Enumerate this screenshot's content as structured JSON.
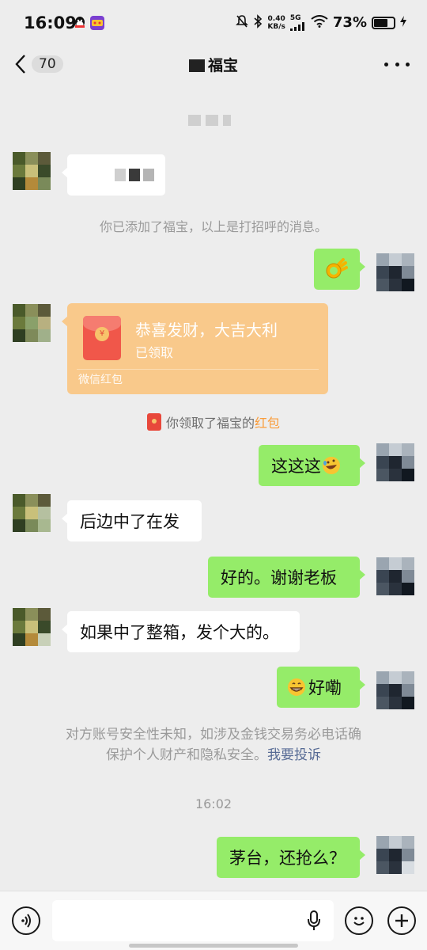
{
  "status_bar": {
    "time": "16:09",
    "network_speed_value": "0.40",
    "network_speed_unit": "KB/s",
    "signal_label": "5G",
    "battery_percent": "73%",
    "battery_level": 0.73
  },
  "nav": {
    "unread_count": "70",
    "title": "福宝",
    "back_icon": "chevron-left-icon",
    "more_icon": "more-dots-icon"
  },
  "messages": {
    "m1_emoji_name": "ok-hand-emoji",
    "system_added": "你已添加了福宝，以上是打招呼的消息。",
    "red_packet": {
      "title": "恭喜发财，大吉大利",
      "status": "已领取",
      "footer": "微信红包"
    },
    "received_notice_prefix": "你领取了福宝的",
    "received_notice_link": "红包",
    "m3_text": "这这这",
    "m3_emoji_name": "rolling-laugh-emoji",
    "m4_text": "后边中了在发",
    "m5_text": "好的。谢谢老板",
    "m6_text": "如果中了整箱，发个大的。",
    "m7_emoji_name": "grin-emoji",
    "m7_text": "好嘞",
    "security_line1": "对方账号安全性未知，如涉及金钱交易务必电话确",
    "security_line2": "保护个人财产和隐私安全。",
    "security_link": "我要投诉",
    "timestamp": "16:02",
    "m8_text": "茅台，还抢么？"
  },
  "input_bar": {
    "voice_icon": "voice-icon",
    "mic_icon": "mic-icon",
    "emoji_icon": "emoji-icon",
    "plus_icon": "plus-icon"
  },
  "colors": {
    "background": "#ededed",
    "sent_bubble": "#95ec69",
    "received_bubble": "#ffffff",
    "red_packet": "#f9c98b",
    "link": "#576b95"
  }
}
